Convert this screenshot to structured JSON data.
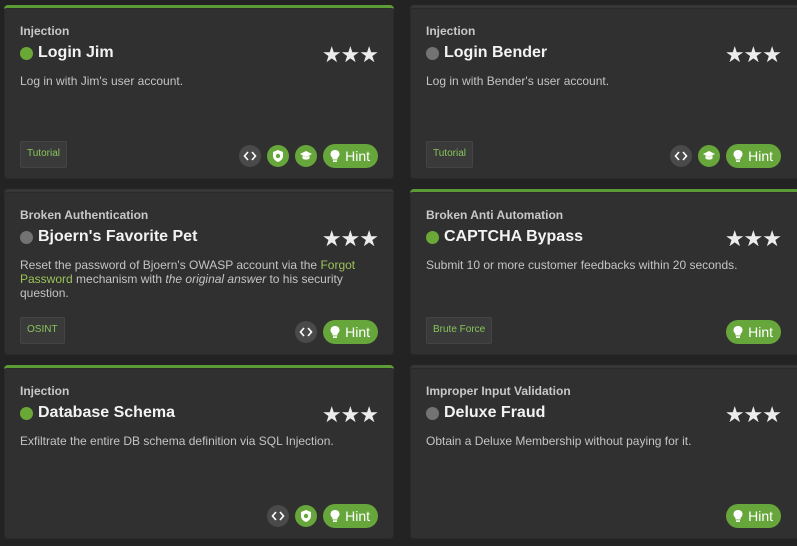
{
  "cards": [
    {
      "category": "Injection",
      "title": "Login Jim",
      "status": "solved",
      "stars": "★★★",
      "description": "Log in with Jim's user account.",
      "tag": "Tutorial",
      "hint_label": "Hint"
    },
    {
      "category": "Injection",
      "title": "Login Bender",
      "status": "unsolved",
      "stars": "★★★",
      "description": "Log in with Bender's user account.",
      "tag": "Tutorial",
      "hint_label": "Hint"
    },
    {
      "category": "Broken Authentication",
      "title": "Bjoern's Favorite Pet",
      "status": "unsolved",
      "stars": "★★★",
      "description_parts": {
        "a": "Reset the password of Bjoern's OWASP account via the ",
        "link": "Forgot Password",
        "b": " mechanism with ",
        "italic": "the original answer",
        "c": " to his security question."
      },
      "tag": "OSINT",
      "hint_label": "Hint"
    },
    {
      "category": "Broken Anti Automation",
      "title": "CAPTCHA Bypass",
      "status": "solved",
      "stars": "★★★",
      "description": "Submit 10 or more customer feedbacks within 20 seconds.",
      "tag": "Brute Force",
      "hint_label": "Hint"
    },
    {
      "category": "Injection",
      "title": "Database Schema",
      "status": "solved",
      "stars": "★★★",
      "description": "Exfiltrate the entire DB schema definition via SQL Injection.",
      "hint_label": "Hint"
    },
    {
      "category": "Improper Input Validation",
      "title": "Deluxe Fraud",
      "status": "unsolved",
      "stars": "★★★",
      "description": "Obtain a Deluxe Membership without paying for it.",
      "hint_label": "Hint"
    }
  ],
  "colors": {
    "accent_green": "#67a63a",
    "solved_dot": "#6aa838",
    "unsolved_dot": "#737373",
    "card_bg": "#303030",
    "page_bg": "#232323"
  },
  "icons": {
    "code": "code-icon",
    "shield": "owasp-shield-icon",
    "tutorial": "graduation-cap-icon",
    "hint": "lightbulb-icon"
  }
}
